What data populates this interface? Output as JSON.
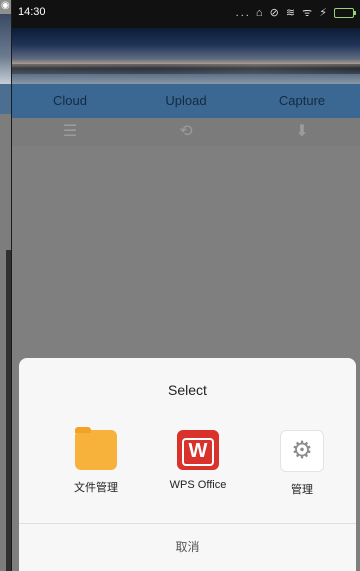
{
  "status_bar": {
    "time": "14:30",
    "icons": "... ⌂ ⊘ ≋ ᯤ ⚡"
  },
  "tabs": [
    {
      "label": "Cloud"
    },
    {
      "label": "Upload"
    },
    {
      "label": "Capture"
    }
  ],
  "toolbar": {
    "icons": [
      "list-icon",
      "sync-icon",
      "download-icon"
    ]
  },
  "dialog": {
    "title": "Select",
    "apps": [
      {
        "label": "文件管理",
        "icon": "folder-icon"
      },
      {
        "label": "WPS Office",
        "icon": "wps-icon"
      },
      {
        "label": "管理",
        "icon": "gear-icon"
      }
    ],
    "cancel_label": "取消"
  },
  "colors": {
    "tab_bar": "#3b6893",
    "folder": "#f7b23b",
    "wps": "#d9312c"
  }
}
